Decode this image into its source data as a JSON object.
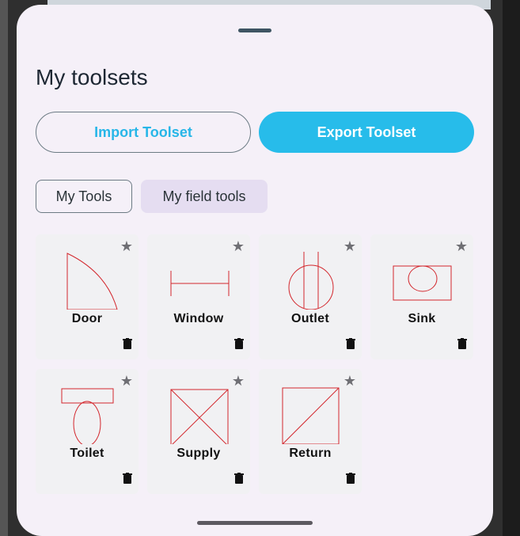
{
  "sheet": {
    "title": "My toolsets",
    "import_label": "Import Toolset",
    "export_label": "Export Toolset",
    "tabs": [
      {
        "label": "My Tools",
        "selected": false
      },
      {
        "label": "My field tools",
        "selected": true
      }
    ]
  },
  "tools": [
    {
      "name": "Door",
      "icon": "door-symbol-icon"
    },
    {
      "name": "Window",
      "icon": "window-symbol-icon"
    },
    {
      "name": "Outlet",
      "icon": "outlet-symbol-icon"
    },
    {
      "name": "Sink",
      "icon": "sink-symbol-icon"
    },
    {
      "name": "Toilet",
      "icon": "toilet-symbol-icon"
    },
    {
      "name": "Supply",
      "icon": "supply-symbol-icon"
    },
    {
      "name": "Return",
      "icon": "return-symbol-icon"
    }
  ],
  "colors": {
    "accent": "#27bcea",
    "sheet_bg": "#f5f0f8",
    "selected_chip": "#e5ddf1",
    "symbol_stroke": "#d3262c"
  }
}
